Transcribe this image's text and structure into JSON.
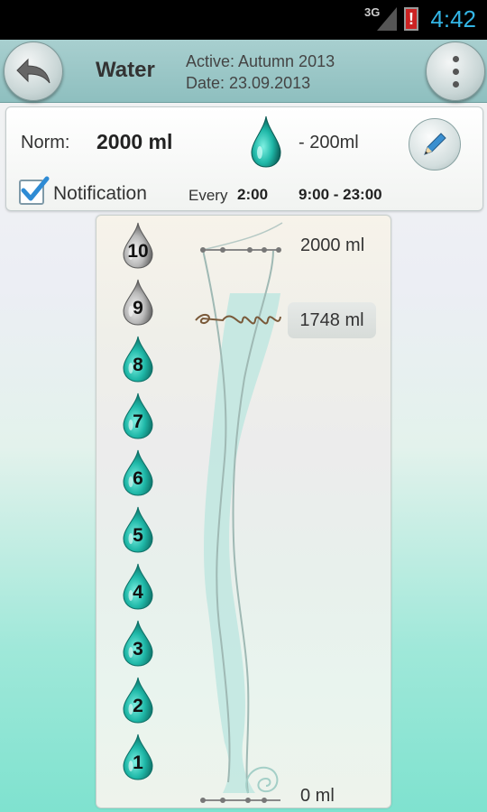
{
  "status_bar": {
    "network": "3G",
    "time": "4:42"
  },
  "action_bar": {
    "title": "Water",
    "season": "Active: Autumn 2013",
    "date": "Date: 23.09.2013"
  },
  "norm": {
    "label": "Norm:",
    "value": "2000 ml",
    "portion": "- 200ml"
  },
  "notification": {
    "label": "Notification",
    "checked": true,
    "every_label": "Every",
    "every_value": "2:00",
    "hours": "9:00 - 23:00"
  },
  "glass": {
    "max_label": "2000 ml",
    "current_label": "1748 ml",
    "min_label": "0 ml",
    "fill_fraction": 0.874,
    "drops": [
      {
        "label": "10",
        "state": "empty"
      },
      {
        "label": "9",
        "state": "empty"
      },
      {
        "label": "8",
        "state": "full"
      },
      {
        "label": "7",
        "state": "full"
      },
      {
        "label": "6",
        "state": "full"
      },
      {
        "label": "5",
        "state": "full"
      },
      {
        "label": "4",
        "state": "full"
      },
      {
        "label": "3",
        "state": "full"
      },
      {
        "label": "2",
        "state": "full"
      },
      {
        "label": "1",
        "state": "full"
      }
    ]
  },
  "colors": {
    "water": "#1fb8a8",
    "water_dark": "#0d6f66",
    "empty_drop": "#9a9a9a",
    "accent": "#33b5e5"
  }
}
